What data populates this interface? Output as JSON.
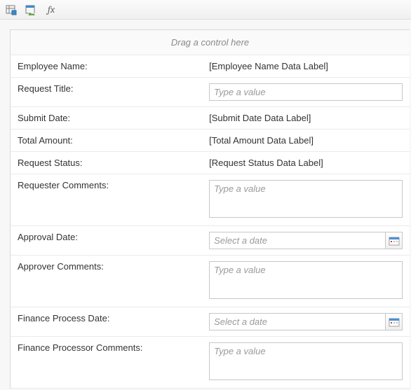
{
  "toolbar": {
    "fx_label": "fx"
  },
  "designer": {
    "drop_hint": "Drag a control here"
  },
  "placeholders": {
    "text": "Type a value",
    "date": "Select a date"
  },
  "fields": [
    {
      "label": "Employee Name:",
      "type": "datalabel",
      "value": "[Employee Name Data Label]"
    },
    {
      "label": "Request Title:",
      "type": "text"
    },
    {
      "label": "Submit Date:",
      "type": "datalabel",
      "value": "[Submit Date Data Label]"
    },
    {
      "label": "Total Amount:",
      "type": "datalabel",
      "value": "[Total Amount Data Label]"
    },
    {
      "label": "Request Status:",
      "type": "datalabel",
      "value": "[Request Status Data Label]"
    },
    {
      "label": "Requester Comments:",
      "type": "multiline"
    },
    {
      "label": "Approval Date:",
      "type": "date"
    },
    {
      "label": "Approver Comments:",
      "type": "multiline"
    },
    {
      "label": "Finance Process Date:",
      "type": "date"
    },
    {
      "label": "Finance Processor Comments:",
      "type": "multiline"
    }
  ]
}
